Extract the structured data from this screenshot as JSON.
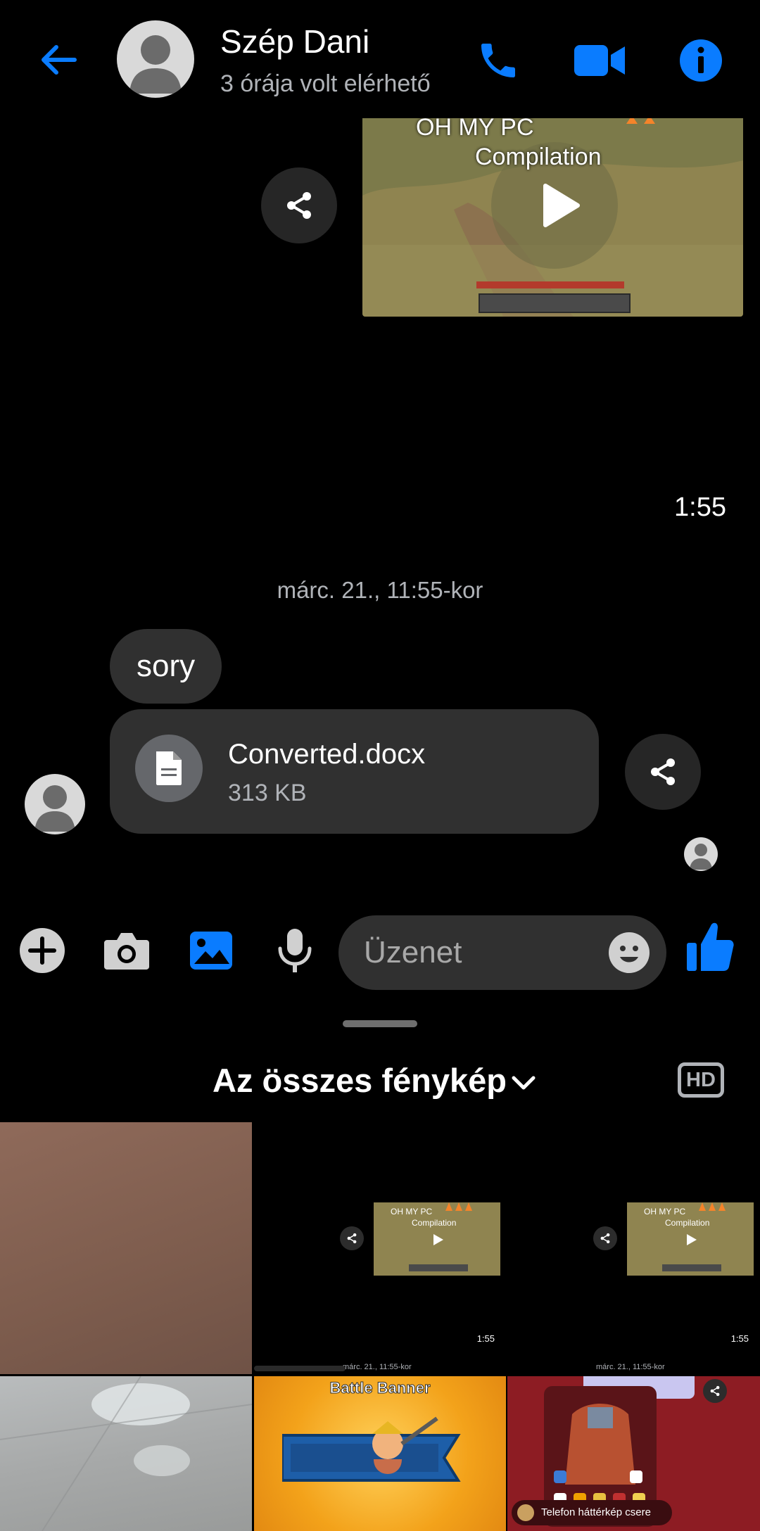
{
  "header": {
    "name": "Szép Dani",
    "status": "3 órája volt elérhető"
  },
  "chat": {
    "video": {
      "title_line1": "OH MY PC",
      "title_line2": "Compilation",
      "time": "1:55"
    },
    "date_divider": "márc. 21., 11:55-kor",
    "messages": [
      {
        "text": "sory"
      }
    ],
    "file": {
      "name": "Converted.docx",
      "size": "313 KB"
    }
  },
  "composer": {
    "placeholder": "Üzenet"
  },
  "gallery": {
    "title": "Az összes fénykép",
    "hd_label": "HD",
    "tiles": [
      {
        "kind": "photo"
      },
      {
        "kind": "screenshot",
        "caption1": "OH MY PC",
        "caption2": "Compilation",
        "time": "1:55",
        "date": "márc. 21., 11:55-kor"
      },
      {
        "kind": "screenshot",
        "caption1": "OH MY PC",
        "caption2": "Compilation",
        "time": "1:55",
        "date": "márc. 21., 11:55-kor"
      },
      {
        "kind": "photo"
      },
      {
        "kind": "game",
        "caption": "Battle Banner"
      },
      {
        "kind": "screenshot",
        "caption": "Telefon háttérkép csere"
      }
    ]
  },
  "colors": {
    "accent": "#0a7cff",
    "bubble": "#303030",
    "background": "#000000",
    "secondary_text": "#b0b3b8"
  }
}
